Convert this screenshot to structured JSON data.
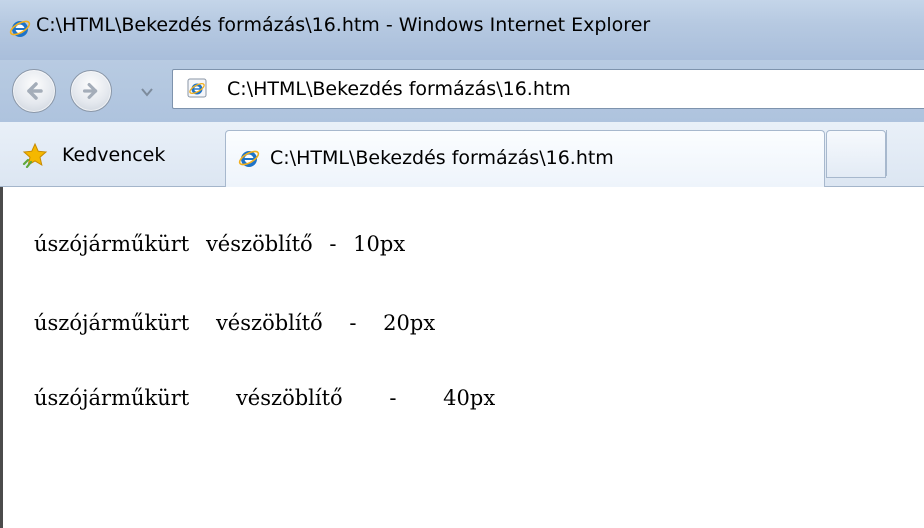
{
  "window": {
    "title": "C:\\HTML\\Bekezdés formázás\\16.htm - Windows Internet Explorer"
  },
  "address_bar": {
    "url": "C:\\HTML\\Bekezdés formázás\\16.htm"
  },
  "favorites": {
    "label": "Kedvencek"
  },
  "tabs": [
    {
      "label": "C:\\HTML\\Bekezdés formázás\\16.htm",
      "active": true
    }
  ],
  "icons": {
    "browser": "ie-icon",
    "back": "back-arrow-icon",
    "forward": "forward-arrow-icon",
    "history": "chevron-down-icon",
    "favorites": "star-icon"
  },
  "content": {
    "lines": [
      {
        "w1": "úszójárműkürt",
        "w2": "vészöblítő",
        "w3": "-",
        "w4": "10px"
      },
      {
        "w1": "úszójárműkürt",
        "w2": "vészöblítő",
        "w3": "-",
        "w4": "20px"
      },
      {
        "w1": "úszójárműkürt",
        "w2": "vészöblítő",
        "w3": "-",
        "w4": "40px"
      }
    ]
  },
  "colors": {
    "chrome": "#b6c9e1",
    "tab_bar": "#e2eaf4",
    "ie_blue": "#1e73c8",
    "ie_ring": "#f2b01e",
    "star": "#f5b800"
  }
}
